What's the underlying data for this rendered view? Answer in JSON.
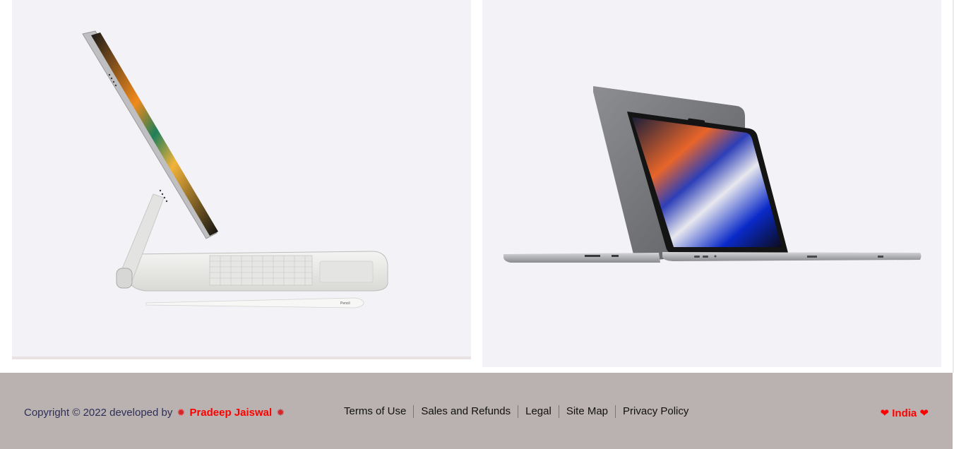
{
  "products": [
    {
      "name": "iPad Pro with Magic Keyboard and Apple Pencil",
      "pencil_label": "Pencil"
    },
    {
      "name": "MacBook Pro"
    }
  ],
  "footer": {
    "copyright_prefix": "Copyright © 2022 developed by",
    "author": "Pradeep Jaiswal",
    "decor_icon": "collision-icon",
    "links": [
      "Terms of Use",
      "Sales and Refunds",
      "Legal",
      "Site Map",
      "Privacy Policy"
    ],
    "country": "India",
    "heart_icon": "heart-icon"
  },
  "colors": {
    "card_bg": "#f3f3f7",
    "footer_bg": "#bab2b0",
    "accent": "#ff0000",
    "copyright_text": "#2e2f57"
  }
}
